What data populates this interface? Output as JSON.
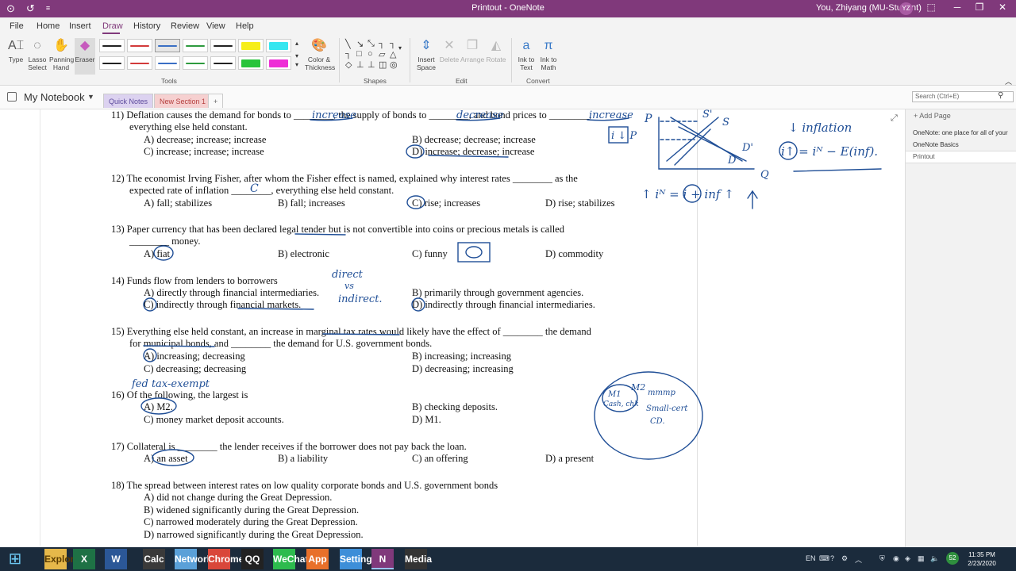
{
  "titlebar": {
    "title": "Printout - OneNote",
    "user": "You, Zhiyang (MU-Student)",
    "initials": "YZ",
    "back_icon": "back-arrow-icon",
    "undo_icon": "undo-icon",
    "customize_icon": "dropdown-icon",
    "minimize": "─",
    "restore": "❐",
    "close": "✕",
    "help": "⬚"
  },
  "menu": {
    "tabs": [
      "File",
      "Home",
      "Insert",
      "Draw",
      "History",
      "Review",
      "View",
      "Help"
    ],
    "active": "Draw"
  },
  "ribbon": {
    "tools": {
      "type": "Type",
      "lasso": "Lasso Select",
      "lasso_1": "Lasso",
      "lasso_2": "Select",
      "panning_1": "Panning",
      "panning_2": "Hand",
      "eraser": "Eraser",
      "color_1": "Color &",
      "color_2": "Thickness",
      "label": "Tools"
    },
    "pens": [
      {
        "color": "#222222",
        "kind": "pen"
      },
      {
        "color": "#d23a3a",
        "kind": "pen"
      },
      {
        "color": "#3a6fc4",
        "kind": "pen",
        "selected": true
      },
      {
        "color": "#2e9a3e",
        "kind": "pen"
      },
      {
        "color": "#222222",
        "kind": "pen"
      },
      {
        "color": "#f6ee1a",
        "kind": "highlighter"
      },
      {
        "color": "#35e6f0",
        "kind": "highlighter"
      },
      {
        "color": "#222222",
        "kind": "pen"
      },
      {
        "color": "#d23a3a",
        "kind": "pen"
      },
      {
        "color": "#3a6fc4",
        "kind": "pen"
      },
      {
        "color": "#2e9a3e",
        "kind": "pen"
      },
      {
        "color": "#222222",
        "kind": "pen"
      },
      {
        "color": "#27c43b",
        "kind": "highlighter"
      },
      {
        "color": "#ee2fd6",
        "kind": "highlighter"
      }
    ],
    "shapes": {
      "label": "Shapes"
    },
    "edit": {
      "insert_space_1": "Insert",
      "insert_space_2": "Space",
      "delete": "Delete",
      "arrange": "Arrange",
      "rotate": "Rotate",
      "label": "Edit"
    },
    "convert": {
      "ink_text_1": "Ink to",
      "ink_text_2": "Text",
      "ink_math_1": "Ink to",
      "ink_math_2": "Math",
      "label": "Convert"
    }
  },
  "notebook": {
    "name": "My Notebook",
    "sections": [
      "Quick Notes",
      "New Section 1"
    ],
    "add_section": "+",
    "search_placeholder": "Search (Ctrl+E)"
  },
  "sidebar": {
    "add_page": "Add Page",
    "pages": [
      "OneNote: one place for all of your",
      "OneNote Basics",
      "Printout"
    ]
  },
  "questions": [
    {
      "lines": [
        "11) Deflation causes the demand for bonds to ________, the supply of bonds to ________, and bond prices to ________,",
        "everything else held constant."
      ],
      "options": [
        [
          "A) decrease; increase; increase",
          "B) decrease; decrease; increase"
        ],
        [
          "C) increase; increase; increase",
          "D) increase; decrease; increase"
        ]
      ]
    },
    {
      "lines": [
        "12) The economist Irving Fisher, after whom the Fisher effect is named, explained why interest rates ________ as the",
        "expected rate of inflation ________, everything else held constant."
      ],
      "options": [
        [
          "A) fall; stabilizes",
          "B) fall; increases",
          "C) rise; increases",
          "D) rise; stabilizes"
        ]
      ]
    },
    {
      "lines": [
        "13) Paper currency that has been declared legal tender but is not convertible into coins or precious metals is called",
        "________ money."
      ],
      "options": [
        [
          "A) fiat",
          "B) electronic",
          "C) funny",
          "D) commodity"
        ]
      ]
    },
    {
      "lines": [
        "14) Funds flow from lenders to borrowers"
      ],
      "options": [
        [
          "A) directly through financial intermediaries.",
          "B) primarily through government agencies."
        ],
        [
          "C) indirectly through financial markets.",
          "D) indirectly through financial intermediaries."
        ]
      ]
    },
    {
      "lines": [
        "15) Everything else held constant, an increase in marginal tax rates would likely have the effect of ________ the demand",
        "for municipal bonds, and ________ the demand for U.S. government bonds."
      ],
      "options": [
        [
          "A) increasing; decreasing",
          "B) increasing; increasing"
        ],
        [
          "C) decreasing; decreasing",
          "D) decreasing; increasing"
        ]
      ]
    },
    {
      "lines": [
        "16) Of the following, the largest is"
      ],
      "options": [
        [
          "A) M2.",
          "B) checking deposits."
        ],
        [
          "C) money market deposit accounts.",
          "D) M1."
        ]
      ]
    },
    {
      "lines": [
        "17) Collateral is ________ the lender receives if the borrower does not pay back the loan."
      ],
      "options": [
        [
          "A) an asset",
          "B) a liability",
          "C) an offering",
          "D) a present"
        ]
      ]
    },
    {
      "lines": [
        "18) The spread between interest rates on low quality corporate bonds and U.S. government bonds"
      ],
      "options": [
        [
          "A) did not change during the Great Depression."
        ],
        [
          "B) widened significantly during the Great Depression."
        ],
        [
          "C) narrowed moderately during the Great Depression."
        ],
        [
          "D) narrowed significantly during the Great Depression."
        ]
      ]
    }
  ],
  "handwriting": {
    "q11_blank1": "increase",
    "q11_blank2": "decrease",
    "q11_blank3": "increase",
    "q12_blank": "C",
    "q14_note_1": "direct",
    "q14_note_2": "vs",
    "q14_note_3": "indirect.",
    "q15_note": "fed tax-exempt",
    "graph_p": "P",
    "graph_s1": "S'",
    "graph_s": "S",
    "graph_d1": "D'",
    "graph_d": "D",
    "graph_q": "Q",
    "graph_ip": "i ↓ P",
    "inflation": "↓ inflation",
    "fisher": "i↑ = iᴺ − E(inf).",
    "fisher2": "↑ iᴺ = i + inf ↑",
    "m2_label": "M2",
    "m1_box_1": "M1",
    "m1_box_2": "Cash, chk",
    "m2_note_1": "mmmp",
    "m2_note_2": "Small-cert",
    "m2_note_3": "CD."
  },
  "taskbar": {
    "apps": [
      "Explorer",
      "X",
      "W",
      "Calc",
      "Network",
      "Chrome",
      "QQ",
      "WeChat",
      "App",
      "Settings",
      "N",
      "Media"
    ],
    "lang": "EN",
    "badge": "52",
    "time": "11:35 PM",
    "date": "2/23/2020"
  }
}
